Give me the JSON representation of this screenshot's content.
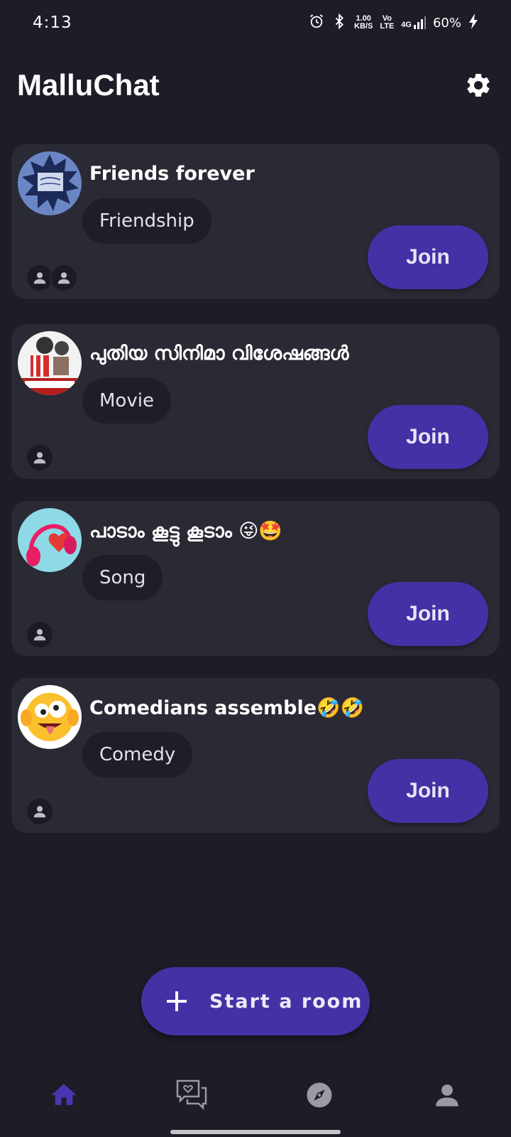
{
  "status_bar": {
    "time": "4:13",
    "net_speed_value": "1.00",
    "net_speed_unit": "KB/S",
    "volte_top": "Vo",
    "volte_bottom": "LTE",
    "network": "4G",
    "battery": "60%"
  },
  "header": {
    "title": "MalluChat",
    "settings_icon": "gear-icon"
  },
  "rooms": [
    {
      "title": "Friends forever",
      "tag": "Friendship",
      "join_label": "Join",
      "members": 2,
      "avatar": "friends-forever-image"
    },
    {
      "title": "പുതിയ സിനിമാ വിശേഷങ്ങൾ",
      "tag": "Movie",
      "join_label": "Join",
      "members": 1,
      "avatar": "movie-night-image"
    },
    {
      "title": "പാടാം കൂട്ടു കൂടാം 😜🤩",
      "tag": "Song",
      "join_label": "Join",
      "members": 1,
      "avatar": "headphones-heart-image"
    },
    {
      "title": "Comedians assemble🤣🤣",
      "tag": "Comedy",
      "join_label": "Join",
      "members": 1,
      "avatar": "crazy-emoji-image"
    }
  ],
  "fab": {
    "label": "Start a room",
    "icon": "plus-icon"
  },
  "bottom_nav": {
    "items": [
      {
        "name": "home",
        "icon": "home-icon",
        "active": true
      },
      {
        "name": "chats",
        "icon": "chat-heart-icon",
        "active": false
      },
      {
        "name": "explore",
        "icon": "compass-icon",
        "active": false
      },
      {
        "name": "profile",
        "icon": "person-icon",
        "active": false
      }
    ]
  },
  "colors": {
    "background": "#1d1d27",
    "card": "#2a2a35",
    "accent": "#4530a5",
    "tag_bg": "#1e1e27"
  }
}
